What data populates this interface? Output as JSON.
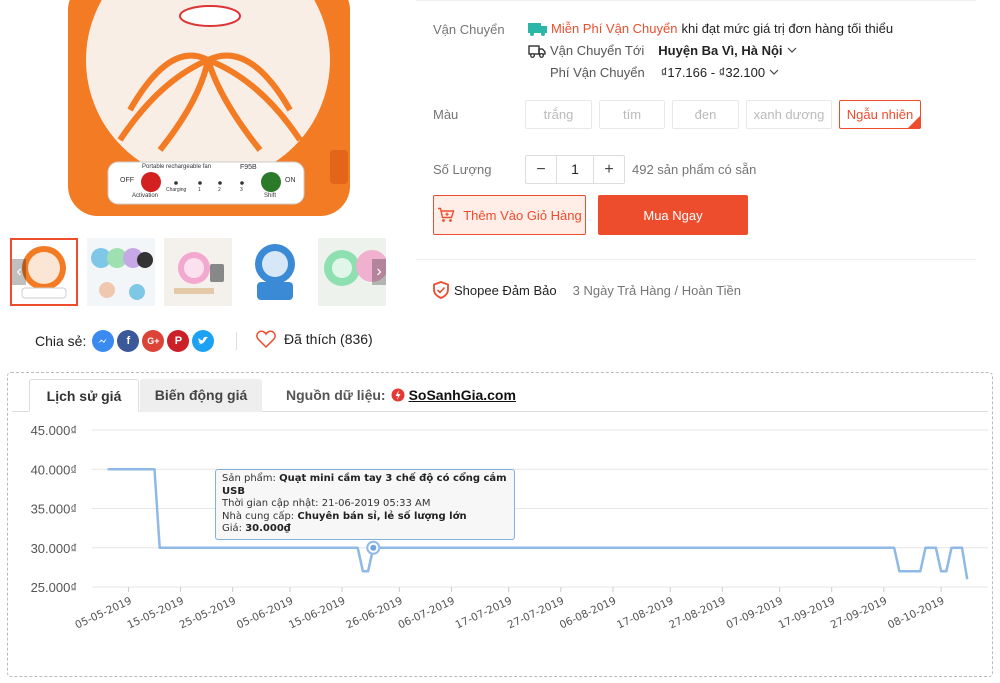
{
  "product_image": {
    "fan_label": "Portable rechargeable fan",
    "model": "F95B",
    "off_label": "OFF",
    "on_label": "ON",
    "activation_label": "Activation",
    "shift_label": "Shift",
    "charging_label": "Charging",
    "speed_labels": [
      "1",
      "2",
      "3"
    ]
  },
  "share": {
    "label": "Chia sẻ:",
    "networks": [
      "messenger",
      "facebook",
      "google-plus",
      "pinterest",
      "twitter"
    ]
  },
  "like": {
    "text": "Đã thích (836)"
  },
  "shipping": {
    "label": "Vận Chuyển",
    "free_text": "Miễn Phí Vận Chuyển",
    "free_condition": "khi đạt mức giá trị đơn hàng tối thiểu",
    "to_label": "Vận Chuyển Tới",
    "to_value": "Huyện Ba Vì, Hà Nội",
    "fee_label": "Phí Vận Chuyển",
    "fee_value": "₫17.166 - ₫32.100"
  },
  "color": {
    "label": "Màu",
    "options": [
      "trắng",
      "tím",
      "đen",
      "xanh dương",
      "Ngẫu nhiên"
    ],
    "selected": "Ngẫu nhiên"
  },
  "quantity": {
    "label": "Số Lượng",
    "value": "1",
    "minus": "−",
    "plus": "+",
    "stock": "492 sản phẩm có sẵn"
  },
  "actions": {
    "add_to_cart": "Thêm Vào Giỏ Hàng",
    "buy_now": "Mua Ngay"
  },
  "guarantee": {
    "title": "Shopee Đảm Bảo",
    "text": "3 Ngày Trả Hàng / Hoàn Tiền"
  },
  "price_widget": {
    "tabs": [
      "Lịch sử giá",
      "Biến động giá"
    ],
    "active_tab": "Lịch sử giá",
    "source_label": "Nguồn dữ liệu:",
    "source_name": "SoSanhGia.com",
    "tooltip": {
      "product_label": "Sản phẩm:",
      "product_value": "Quạt mini cầm tay 3 chế độ có cổng cắm USB",
      "time_label": "Thời gian cập nhật:",
      "time_value": "21-06-2019 05:33 AM",
      "supplier_label": "Nhà cung cấp:",
      "supplier_value": "Chuyên bán sỉ, lẻ số lượng lớn",
      "price_label": "Giá:",
      "price_value": "30.000₫"
    }
  },
  "chart_data": {
    "type": "line",
    "title": "",
    "xlabel": "",
    "ylabel": "",
    "ylim": [
      25000,
      45000
    ],
    "y_ticks": [
      "25.000₫",
      "30.000₫",
      "35.000₫",
      "40.000₫",
      "45.000₫"
    ],
    "y_tick_values": [
      25000,
      30000,
      35000,
      40000,
      45000
    ],
    "x_ticks": [
      "05-05-2019",
      "15-05-2019",
      "25-05-2019",
      "05-06-2019",
      "15-06-2019",
      "26-06-2019",
      "06-07-2019",
      "17-07-2019",
      "27-07-2019",
      "06-08-2019",
      "17-08-2019",
      "27-08-2019",
      "07-09-2019",
      "17-09-2019",
      "27-09-2019",
      "08-10-2019"
    ],
    "grid": true,
    "line_color": "#8fb9e6",
    "series": [
      {
        "x": [
          "2019-05-01",
          "2019-05-05",
          "2019-05-10",
          "2019-05-11",
          "2019-06-18",
          "2019-06-19",
          "2019-06-20",
          "2019-06-21",
          "2019-09-29",
          "2019-09-30",
          "2019-10-04",
          "2019-10-05",
          "2019-10-07",
          "2019-10-08",
          "2019-10-09",
          "2019-10-10",
          "2019-10-12",
          "2019-10-13"
        ],
        "values": [
          40000,
          40000,
          40000,
          30000,
          30000,
          27000,
          27000,
          30000,
          30000,
          27000,
          27000,
          30000,
          30000,
          27000,
          27000,
          30000,
          30000,
          26000
        ]
      }
    ],
    "highlight": {
      "x": "2019-06-21",
      "value": 30000
    }
  }
}
